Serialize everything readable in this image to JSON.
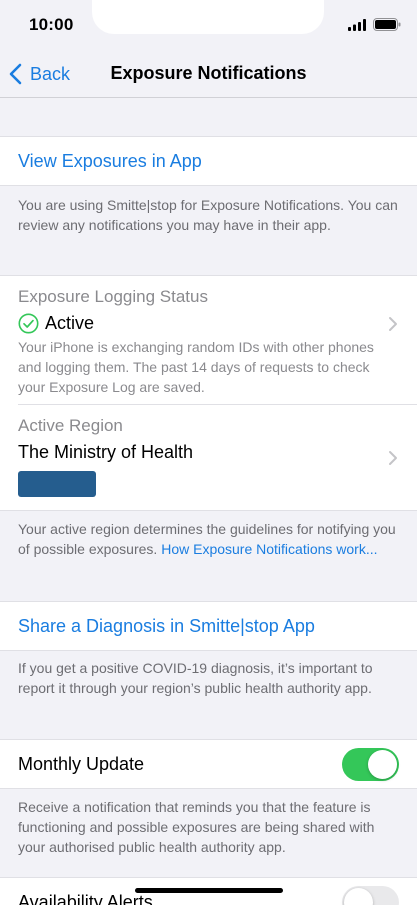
{
  "status_bar": {
    "time": "10:00"
  },
  "nav": {
    "back_label": "Back",
    "title": "Exposure Notifications"
  },
  "view_exposures": {
    "link_label": "View Exposures in App",
    "footnote": "You are using Smitte|stop for Exposure Notifications. You can review any notifications you may have in their app."
  },
  "logging": {
    "label": "Exposure Logging Status",
    "status": "Active",
    "description": "Your iPhone is exchanging random IDs with other phones and logging them. The past 14 days of requests to check your Exposure Log are saved."
  },
  "region": {
    "label": "Active Region",
    "name": "The Ministry of Health",
    "footnote_text": "Your active region determines the guidelines for notifying you of possible exposures. ",
    "footnote_link": "How Exposure Notifications work..."
  },
  "share": {
    "link_label": "Share a Diagnosis in Smitte|stop App",
    "footnote": "If you get a positive COVID-19 diagnosis, it’s important to report it through your region’s public health authority app."
  },
  "monthly_update": {
    "label": "Monthly Update",
    "enabled": true,
    "footnote": "Receive a notification that reminds you that the feature is functioning and possible exposures are being shared with your authorised public health authority app."
  },
  "availability_alerts": {
    "label": "Availability Alerts",
    "enabled": false
  },
  "colors": {
    "accent": "#1a7de0",
    "toggle_on": "#34c759",
    "active_check": "#34c759",
    "badge": "#255d8e"
  }
}
